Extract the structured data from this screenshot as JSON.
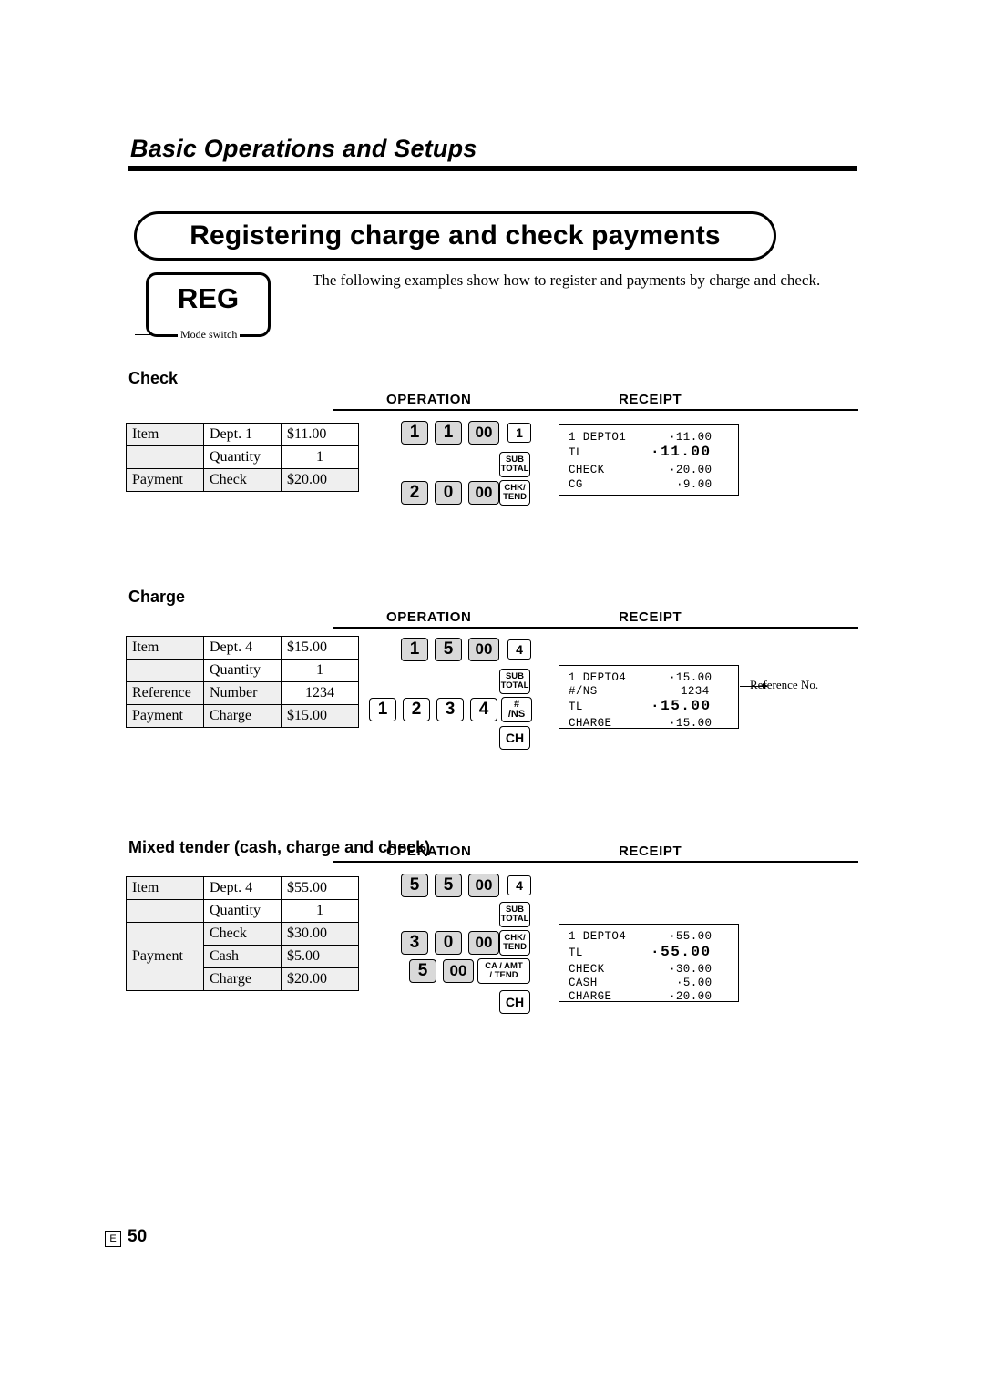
{
  "header": {
    "section_title": "Basic Operations and Setups",
    "page_title": "Registering charge and check payments",
    "mode_label": "REG",
    "mode_switch_caption": "Mode switch",
    "intro": "The following examples show how to register and payments by charge and check."
  },
  "column_headers": {
    "operation": "OPERATION",
    "receipt": "RECEIPT"
  },
  "sections": [
    {
      "name": "check",
      "title": "Check",
      "table": [
        {
          "label": "Item",
          "mid": "Dept. 1",
          "val": "$11.00"
        },
        {
          "label": "",
          "mid": "Quantity",
          "val": "1"
        },
        {
          "label": "Payment",
          "mid": "Check",
          "val": "$20.00"
        }
      ],
      "keys": [
        {
          "name": "key-1",
          "label": "1",
          "type": "num"
        },
        {
          "name": "key-1",
          "label": "1",
          "type": "num"
        },
        {
          "name": "key-00",
          "label": "00",
          "type": "dbl"
        },
        {
          "name": "key-dept-1",
          "label": "1",
          "type": "dept"
        },
        {
          "name": "key-subtotal",
          "line1": "SUB",
          "line2": "TOTAL",
          "type": "fn"
        },
        {
          "name": "key-2",
          "label": "2",
          "type": "num"
        },
        {
          "name": "key-0",
          "label": "0",
          "type": "num"
        },
        {
          "name": "key-00",
          "label": "00",
          "type": "dbl"
        },
        {
          "name": "key-chk-tend",
          "line1": "CHK/",
          "line2": "TEND",
          "type": "fn"
        }
      ],
      "receipt": [
        {
          "left": "1 DEPTO1",
          "right": "·11.00"
        },
        {
          "left": "TL",
          "right": "·11.00",
          "big": true
        },
        {
          "left": "CHECK",
          "right": "·20.00"
        },
        {
          "left": "CG",
          "right": "·9.00"
        }
      ]
    },
    {
      "name": "charge",
      "title": "Charge",
      "table": [
        {
          "label": "Item",
          "mid": "Dept. 4",
          "val": "$15.00"
        },
        {
          "label": "",
          "mid": "Quantity",
          "val": "1"
        },
        {
          "label": "Reference",
          "mid": "Number",
          "val": "1234"
        },
        {
          "label": "Payment",
          "mid": "Charge",
          "val": "$15.00"
        }
      ],
      "keys": [
        {
          "name": "key-1",
          "label": "1",
          "type": "num"
        },
        {
          "name": "key-5",
          "label": "5",
          "type": "num"
        },
        {
          "name": "key-00",
          "label": "00",
          "type": "dbl"
        },
        {
          "name": "key-dept-4",
          "label": "4",
          "type": "dept"
        },
        {
          "name": "key-subtotal",
          "line1": "SUB",
          "line2": "TOTAL",
          "type": "fn"
        },
        {
          "name": "key-1",
          "label": "1",
          "type": "num"
        },
        {
          "name": "key-2",
          "label": "2",
          "type": "num"
        },
        {
          "name": "key-3",
          "label": "3",
          "type": "num"
        },
        {
          "name": "key-4",
          "label": "4",
          "type": "num"
        },
        {
          "name": "key-hash-ns",
          "line1": "#",
          "line2": "/NS",
          "type": "hash"
        },
        {
          "name": "key-ch",
          "label": "CH",
          "type": "ch"
        }
      ],
      "receipt": [
        {
          "left": "1 DEPTO4",
          "right": "·15.00"
        },
        {
          "left": "#/NS",
          "right": "1234"
        },
        {
          "left": "TL",
          "right": "·15.00",
          "big": true
        },
        {
          "left": "CHARGE",
          "right": "·15.00"
        }
      ],
      "annotation": "Reference No."
    },
    {
      "name": "mixed",
      "title": "Mixed tender (cash, charge and check)",
      "table": [
        {
          "label": "Item",
          "mid": "Dept. 4",
          "val": "$55.00"
        },
        {
          "label": "",
          "mid": "Quantity",
          "val": "1"
        },
        {
          "label": "Payment",
          "mid": "Check",
          "val": "$30.00"
        },
        {
          "label": "",
          "mid": "Cash",
          "val": "$5.00"
        },
        {
          "label": "",
          "mid": "Charge",
          "val": "$20.00"
        }
      ],
      "keys": [
        {
          "name": "key-5",
          "label": "5",
          "type": "num"
        },
        {
          "name": "key-5",
          "label": "5",
          "type": "num"
        },
        {
          "name": "key-00",
          "label": "00",
          "type": "dbl"
        },
        {
          "name": "key-dept-4",
          "label": "4",
          "type": "dept"
        },
        {
          "name": "key-subtotal",
          "line1": "SUB",
          "line2": "TOTAL",
          "type": "fn"
        },
        {
          "name": "key-3",
          "label": "3",
          "type": "num"
        },
        {
          "name": "key-0",
          "label": "0",
          "type": "num"
        },
        {
          "name": "key-00",
          "label": "00",
          "type": "dbl"
        },
        {
          "name": "key-chk-tend",
          "line1": "CHK/",
          "line2": "TEND",
          "type": "fn"
        },
        {
          "name": "key-5",
          "label": "5",
          "type": "num"
        },
        {
          "name": "key-00",
          "label": "00",
          "type": "dbl"
        },
        {
          "name": "key-ca-amt-tend",
          "line1": "CA / AMT",
          "line2": "/ TEND",
          "type": "wide"
        },
        {
          "name": "key-ch",
          "label": "CH",
          "type": "ch"
        }
      ],
      "receipt": [
        {
          "left": "1 DEPTO4",
          "right": "·55.00"
        },
        {
          "left": "TL",
          "right": "·55.00",
          "big": true
        },
        {
          "left": "CHECK",
          "right": "·30.00"
        },
        {
          "left": "CASH",
          "right": "·5.00"
        },
        {
          "left": "CHARGE",
          "right": "·20.00"
        }
      ]
    }
  ],
  "footer": {
    "lang": "E",
    "page": "50"
  }
}
